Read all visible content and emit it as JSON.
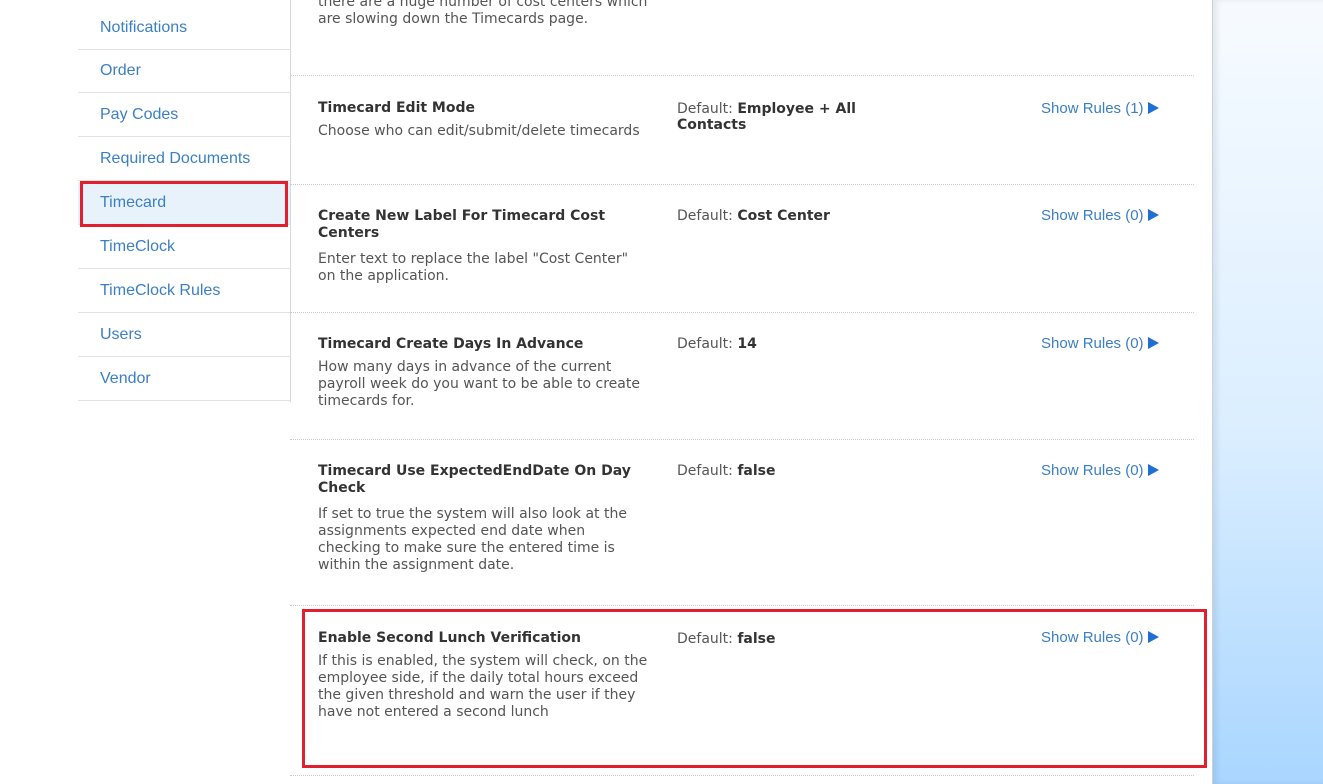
{
  "sidebar": {
    "items": [
      {
        "label": "Notifications"
      },
      {
        "label": "Order"
      },
      {
        "label": "Pay Codes"
      },
      {
        "label": "Required Documents"
      },
      {
        "label": "Timecard"
      },
      {
        "label": "TimeClock"
      },
      {
        "label": "TimeClock Rules"
      },
      {
        "label": "Users"
      },
      {
        "label": "Vendor"
      }
    ],
    "active": "Timecard"
  },
  "settings": {
    "default_label": "Default:",
    "rows": [
      {
        "title": "",
        "description": "there are a huge number of cost centers which are slowing down the Timecards page.",
        "default_value": "",
        "rules": ""
      },
      {
        "title": "Timecard Edit Mode",
        "description": "Choose who can edit/submit/delete timecards",
        "default_value": "Employee + All Contacts",
        "rules": "Show Rules (1)"
      },
      {
        "title": "Create New Label For Timecard Cost Centers",
        "description": "Enter text to replace the label \"Cost Center\" on the application.",
        "default_value": "Cost Center",
        "rules": "Show Rules (0)"
      },
      {
        "title": "Timecard Create Days In Advance",
        "description": "How many days in advance of the current payroll week do you want to be able to create timecards for.",
        "default_value": "14",
        "rules": "Show Rules (0)"
      },
      {
        "title": "Timecard Use ExpectedEndDate On Day Check",
        "description": "If set to true the system will also look at the assignments expected end date when checking to make sure the entered time is within the assignment date.",
        "default_value": "false",
        "rules": "Show Rules (0)"
      },
      {
        "title": "Enable Second Lunch Verification",
        "description": "If this is enabled, the system will check, on the employee side, if the daily total hours exceed the given threshold and warn the user if they have not entered a second lunch",
        "default_value": "false",
        "rules": "Show Rules (0)"
      }
    ]
  },
  "colors": {
    "link": "#3b7fc4",
    "highlight": "#e0202e",
    "arrow": "#1f6fd4"
  },
  "icons": {
    "rules_arrow": "triangle-right-icon"
  }
}
